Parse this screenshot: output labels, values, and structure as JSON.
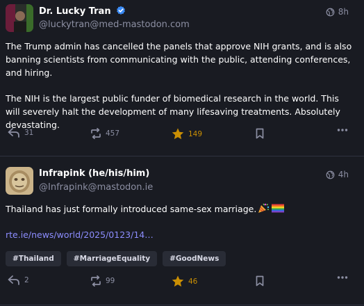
{
  "posts": [
    {
      "author": "Dr. Lucky Tran",
      "handle": "@luckytran@med-mastodon.com",
      "time": "8h",
      "verified": true,
      "paragraphs": [
        "The Trump admin has cancelled the panels that approve NIH grants, and is also banning scientists from communicating with the public, attending conferences, and hiring.",
        "The NIH is the largest public funder of biomedical research in the world. This will severely halt the development of many lifesaving treatments. Absolutely devastating."
      ],
      "replies": "31",
      "boosts": "457",
      "favourites": "149"
    },
    {
      "author": "Infrapink (he/his/him)",
      "handle": "@Infrapink@mastodon.ie",
      "time": "4h",
      "text": "Thailand has just formally introduced same-sex marriage.",
      "emoji": [
        "party-popper-icon",
        "rainbow-flag-icon"
      ],
      "link": "rte.ie/news/world/2025/0123/14…",
      "hashtags": [
        "#Thailand",
        "#MarriageEquality",
        "#GoodNews"
      ],
      "replies": "2",
      "boosts": "99",
      "favourites": "46"
    }
  ],
  "colors": {
    "background": "#191b22",
    "muted": "#8c8fa3",
    "link": "#8c8dff",
    "star": "#ca8f04",
    "verified": "#3a8bf6"
  }
}
